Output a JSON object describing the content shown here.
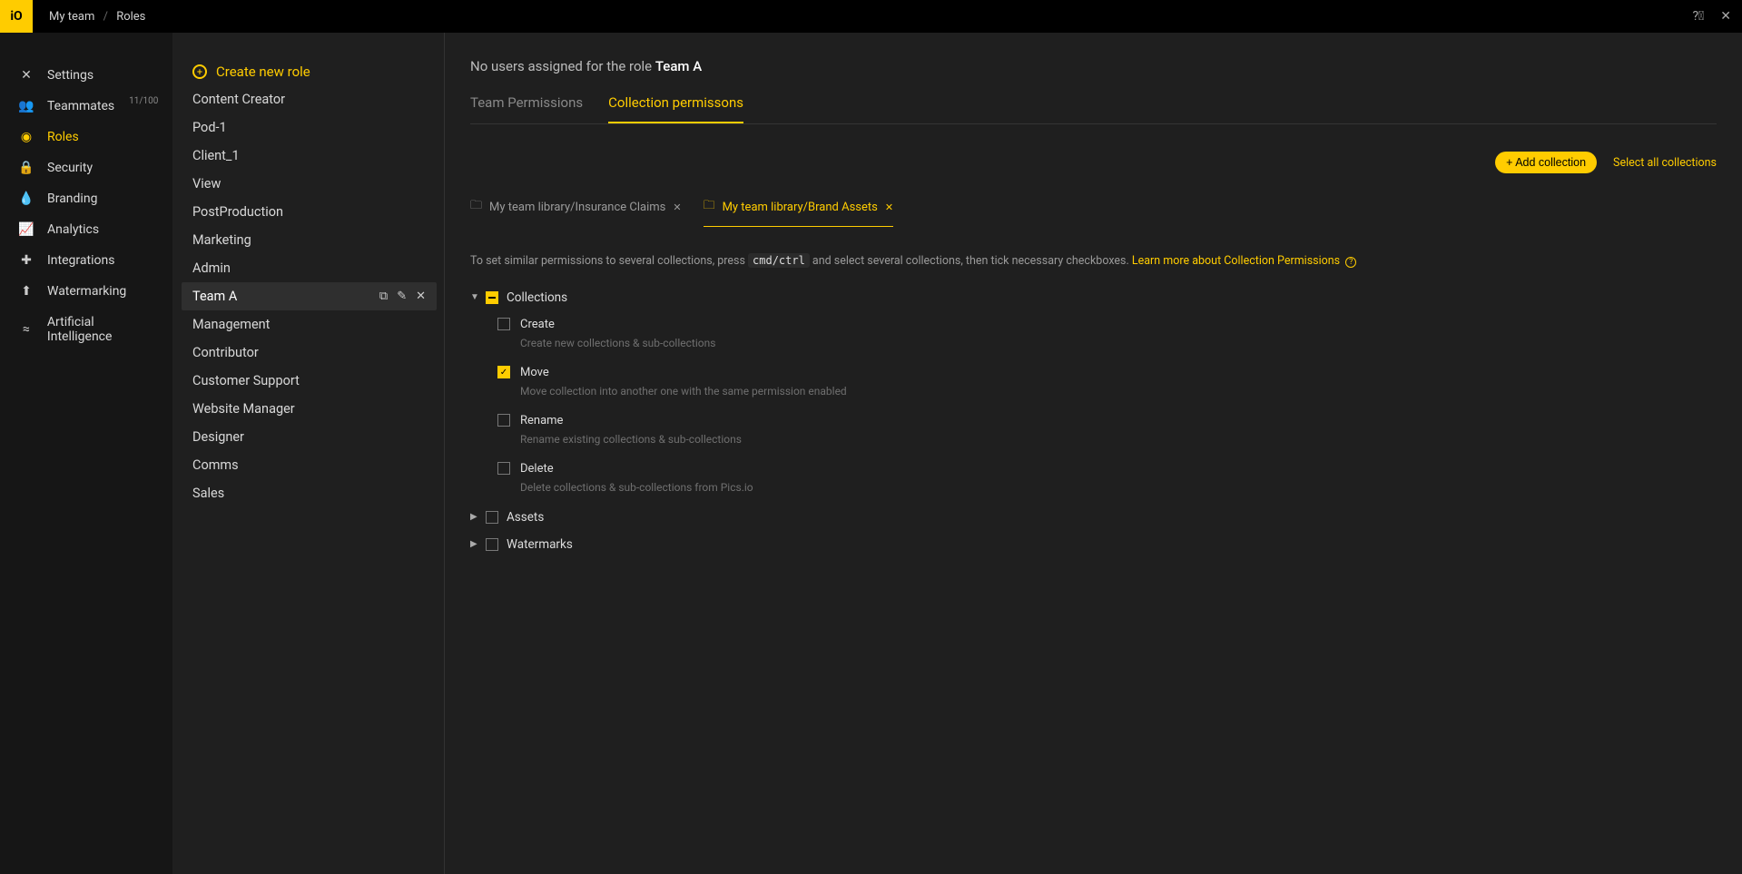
{
  "logo": "iO",
  "breadcrumb": {
    "root": "My team",
    "current": "Roles"
  },
  "sidebar": {
    "items": [
      {
        "label": "Settings",
        "icon": "✕",
        "active": false
      },
      {
        "label": "Teammates",
        "icon": "👥",
        "badge": "11/100",
        "active": false
      },
      {
        "label": "Roles",
        "icon": "◉",
        "active": true
      },
      {
        "label": "Security",
        "icon": "🔒",
        "active": false
      },
      {
        "label": "Branding",
        "icon": "💧",
        "active": false
      },
      {
        "label": "Analytics",
        "icon": "📈",
        "active": false
      },
      {
        "label": "Integrations",
        "icon": "✚",
        "active": false
      },
      {
        "label": "Watermarking",
        "icon": "⬆",
        "active": false
      },
      {
        "label": "Artificial Intelligence",
        "icon": "≈",
        "active": false
      }
    ]
  },
  "rolesColumn": {
    "create": "Create new role",
    "items": [
      "Content Creator",
      "Pod-1",
      "Client_1",
      "View",
      "PostProduction",
      "Marketing",
      "Admin",
      "Team A",
      "Management",
      "Contributor",
      "Customer Support",
      "Website Manager",
      "Designer",
      "Comms",
      "Sales"
    ],
    "selected": "Team A"
  },
  "main": {
    "headerPrefix": "No users assigned for the role ",
    "headerRole": "Team A",
    "tabs": [
      {
        "label": "Team Permissions",
        "active": false
      },
      {
        "label": "Collection permissons",
        "active": true
      }
    ],
    "toolbar": {
      "add": "+ Add collection",
      "selectAll": "Select all collections"
    },
    "chips": [
      {
        "label": "My team library/Insurance Claims",
        "active": false
      },
      {
        "label": "My team library/Brand Assets",
        "active": true
      }
    ],
    "hint": {
      "pre": "To set similar permissions to several collections, press ",
      "code": "cmd/ctrl",
      "post": " and select several collections, then tick necessary checkboxes. ",
      "link": "Learn more about Collection Permissions"
    },
    "sections": [
      {
        "name": "Collections",
        "expanded": true,
        "state": "partial",
        "perms": [
          {
            "name": "Create",
            "desc": "Create new collections & sub-collections",
            "checked": false
          },
          {
            "name": "Move",
            "desc": "Move collection into another one with the same permission enabled",
            "checked": true
          },
          {
            "name": "Rename",
            "desc": "Rename existing collections & sub-collections",
            "checked": false
          },
          {
            "name": "Delete",
            "desc": "Delete collections & sub-collections from Pics.io",
            "checked": false
          }
        ]
      },
      {
        "name": "Assets",
        "expanded": false,
        "state": "unchecked"
      },
      {
        "name": "Watermarks",
        "expanded": false,
        "state": "unchecked"
      }
    ]
  }
}
